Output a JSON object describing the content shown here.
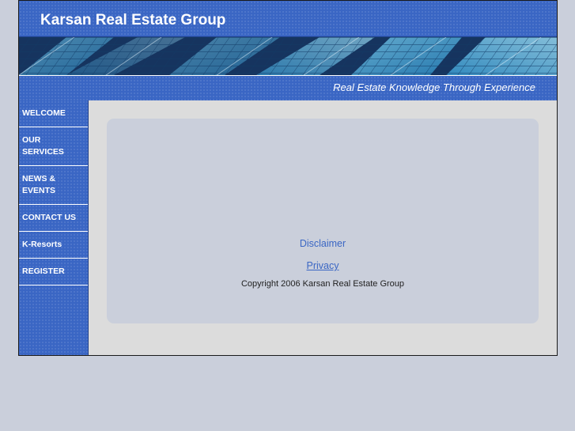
{
  "header": {
    "site_title": "Karsan Real Estate Group",
    "tagline": "Real Estate Knowledge Through Experience"
  },
  "nav": {
    "items": [
      {
        "label": "WELCOME"
      },
      {
        "label": "OUR SERVICES"
      },
      {
        "label": "NEWS & EVENTS"
      },
      {
        "label": "CONTACT US"
      },
      {
        "label": "K-Resorts"
      },
      {
        "label": "REGISTER"
      }
    ]
  },
  "footer": {
    "disclaimer": "Disclaimer",
    "privacy": "Privacy",
    "copyright": "Copyright 2006 Karsan Real Estate Group"
  },
  "colors": {
    "brand_blue": "#3a66c4",
    "page_bg": "#cacfdb",
    "content_bg": "#dcdcdc"
  },
  "banner": {
    "image": "glass-building-facade"
  }
}
